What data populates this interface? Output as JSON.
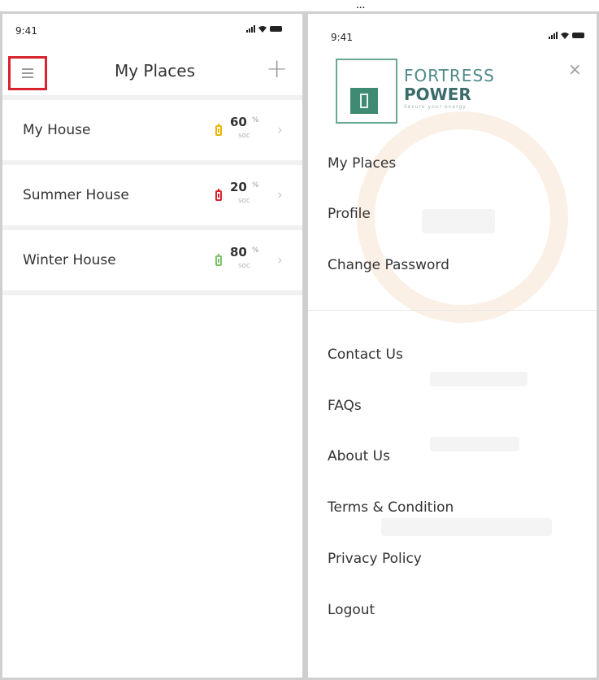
{
  "caption": "...",
  "status": {
    "time": "9:41"
  },
  "places": {
    "title": "My Places",
    "add_symbol": "+",
    "items": [
      {
        "name": "My House",
        "pct": "60",
        "unit": "%",
        "soc": "SOC",
        "color": "#f0b400"
      },
      {
        "name": "Summer House",
        "pct": "20",
        "unit": "%",
        "soc": "SOC",
        "color": "#d9232d"
      },
      {
        "name": "Winter House",
        "pct": "80",
        "unit": "%",
        "soc": "SOC",
        "color": "#7cc36b"
      }
    ]
  },
  "drawer": {
    "brand_line1": "FORTRESS",
    "brand_line2": "POWER",
    "brand_tagline": "Secure your energy",
    "close_symbol": "×",
    "menu_primary": [
      "My Places",
      "Profile",
      "Change Password"
    ],
    "menu_secondary": [
      "Contact Us",
      "FAQs",
      "About Us",
      "Terms & Condition",
      "Privacy Policy",
      "Logout"
    ]
  },
  "colors": {
    "highlight_red": "#d9232d",
    "brand_green": "#3f8a73"
  }
}
